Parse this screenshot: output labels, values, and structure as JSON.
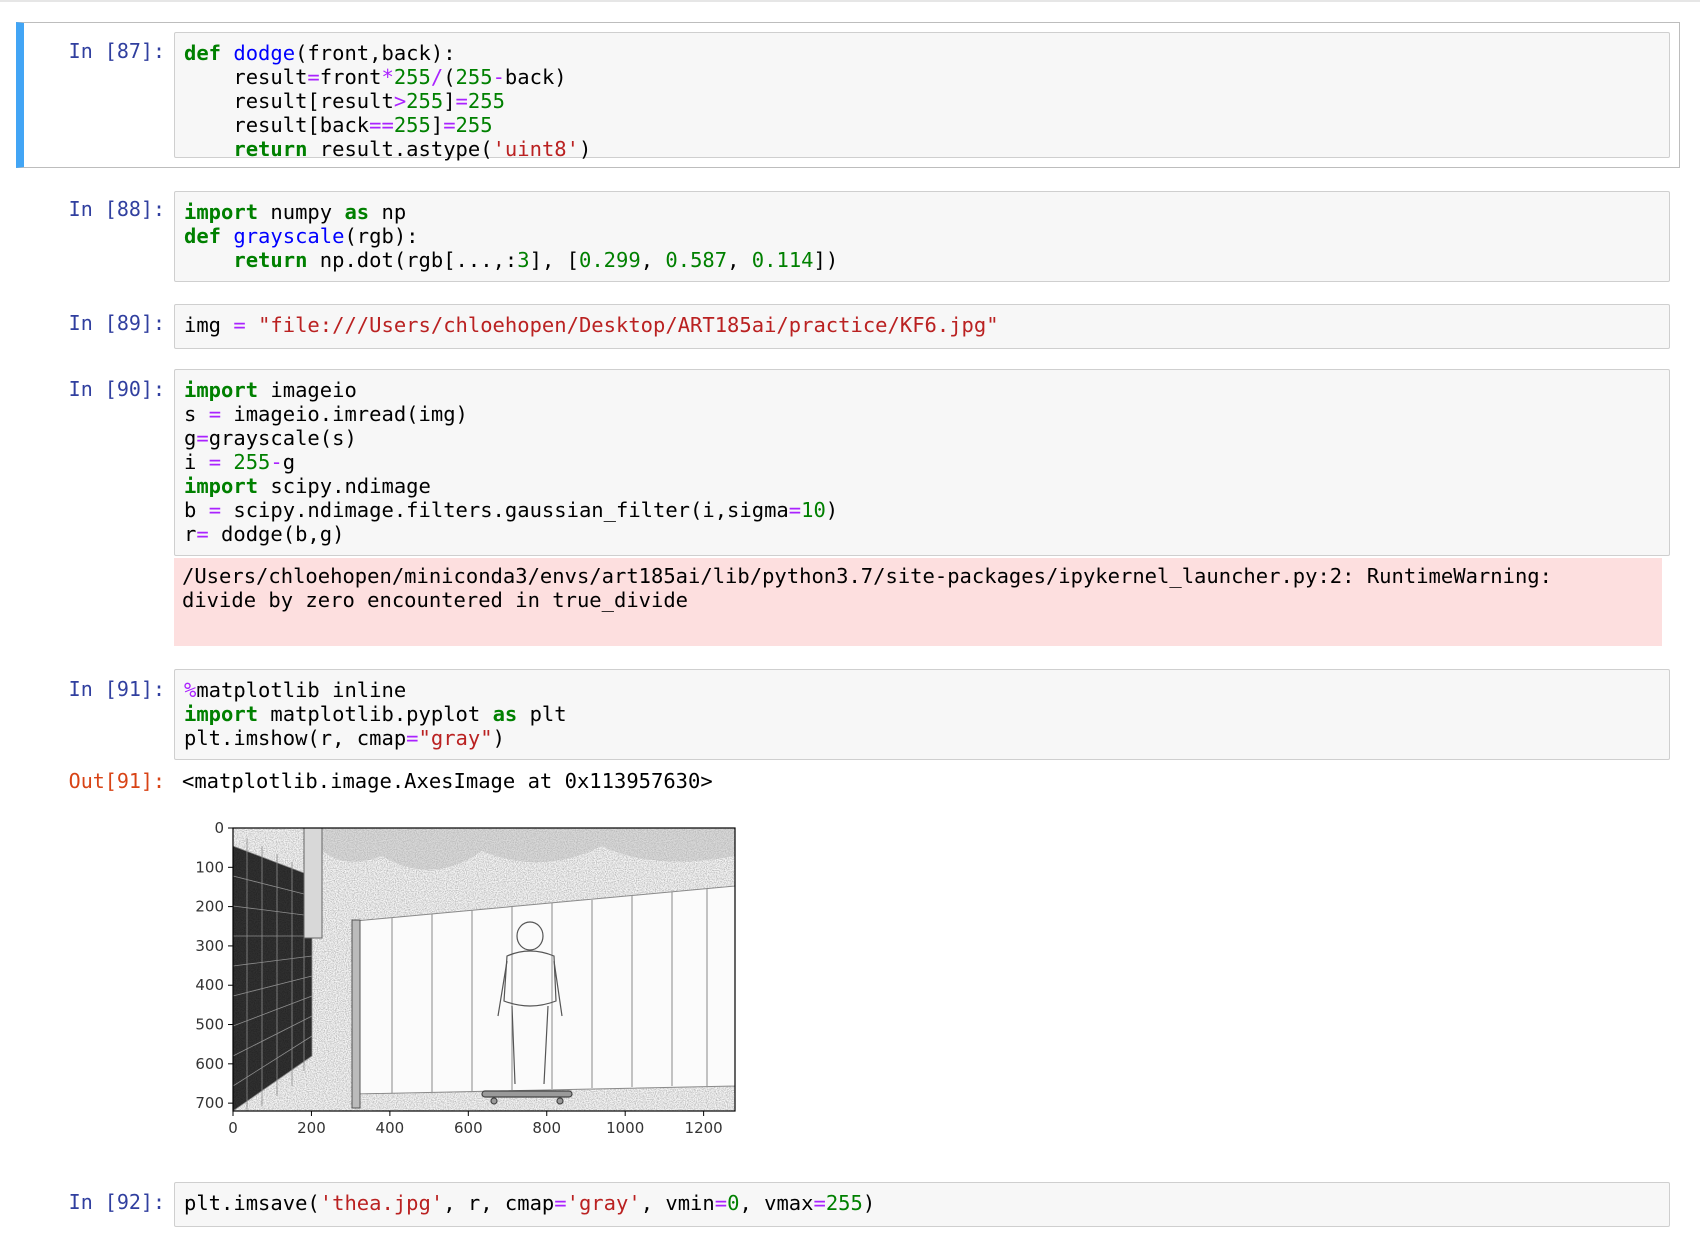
{
  "cells": [
    {
      "prompt": "In [87]:"
    },
    {
      "prompt": "In [88]:"
    },
    {
      "prompt": "In [89]:"
    },
    {
      "prompt": "In [90]:",
      "stderr": "/Users/chloehopen/miniconda3/envs/art185ai/lib/python3.7/site-packages/ipykernel_launcher.py:2: RuntimeWarning:\ndivide by zero encountered in true_divide"
    },
    {
      "prompt": "In [91]:",
      "out_prompt": "Out[91]:",
      "output": "<matplotlib.image.AxesImage at 0x113957630>"
    },
    {
      "prompt": "In [92]:"
    }
  ],
  "code": {
    "c87": [
      [
        [
          "def",
          "kw"
        ],
        [
          " ",
          ""
        ],
        [
          "dodge",
          "fn"
        ],
        [
          "(front,back):",
          ""
        ]
      ],
      [
        [
          "    result",
          ""
        ],
        [
          "=",
          "op"
        ],
        [
          "front",
          ""
        ],
        [
          "*",
          "op"
        ],
        [
          "255",
          "num"
        ],
        [
          "/",
          "op"
        ],
        [
          "(",
          ""
        ],
        [
          "255",
          "num"
        ],
        [
          "-",
          "op"
        ],
        [
          "back)",
          ""
        ]
      ],
      [
        [
          "    result[result",
          ""
        ],
        [
          ">",
          "op"
        ],
        [
          "255",
          "num"
        ],
        [
          "]",
          ""
        ],
        [
          "=",
          "op"
        ],
        [
          "255",
          "num"
        ]
      ],
      [
        [
          "    result[back",
          ""
        ],
        [
          "==",
          "op"
        ],
        [
          "255",
          "num"
        ],
        [
          "]",
          ""
        ],
        [
          "=",
          "op"
        ],
        [
          "255",
          "num"
        ]
      ],
      [
        [
          "    ",
          ""
        ],
        [
          "return",
          "kw"
        ],
        [
          " result.astype(",
          ""
        ],
        [
          "'uint8'",
          "str"
        ],
        [
          ")",
          ""
        ]
      ]
    ],
    "c88": [
      [
        [
          "import",
          "kw"
        ],
        [
          " numpy ",
          ""
        ],
        [
          "as",
          "kw"
        ],
        [
          " np",
          ""
        ]
      ],
      [
        [
          "def",
          "kw"
        ],
        [
          " ",
          ""
        ],
        [
          "grayscale",
          "fn"
        ],
        [
          "(rgb):",
          ""
        ]
      ],
      [
        [
          "    ",
          ""
        ],
        [
          "return",
          "kw"
        ],
        [
          " np.dot(rgb[...,:",
          ""
        ],
        [
          "3",
          "num"
        ],
        [
          "], [",
          ""
        ],
        [
          "0.299",
          "num"
        ],
        [
          ", ",
          ""
        ],
        [
          "0.587",
          "num"
        ],
        [
          ", ",
          ""
        ],
        [
          "0.114",
          "num"
        ],
        [
          "])",
          ""
        ]
      ]
    ],
    "c89": [
      [
        [
          "img ",
          ""
        ],
        [
          "=",
          "op"
        ],
        [
          " ",
          ""
        ],
        [
          "\"file:///Users/chloehopen/Desktop/ART185ai/practice/KF6.jpg\"",
          "str"
        ]
      ]
    ],
    "c90": [
      [
        [
          "import",
          "kw"
        ],
        [
          " imageio",
          ""
        ]
      ],
      [
        [
          "s ",
          ""
        ],
        [
          "=",
          "op"
        ],
        [
          " imageio.imread(img)",
          ""
        ]
      ],
      [
        [
          "g",
          ""
        ],
        [
          "=",
          "op"
        ],
        [
          "grayscale(s)",
          ""
        ]
      ],
      [
        [
          "i ",
          ""
        ],
        [
          "=",
          "op"
        ],
        [
          " ",
          ""
        ],
        [
          "255",
          "num"
        ],
        [
          "-",
          "op"
        ],
        [
          "g",
          ""
        ]
      ],
      [
        [
          "import",
          "kw"
        ],
        [
          " scipy.ndimage",
          ""
        ]
      ],
      [
        [
          "b ",
          ""
        ],
        [
          "=",
          "op"
        ],
        [
          " scipy.ndimage.filters.gaussian_filter(i,sigma",
          ""
        ],
        [
          "=",
          "op"
        ],
        [
          "10",
          "num"
        ],
        [
          ")",
          ""
        ]
      ],
      [
        [
          "r",
          ""
        ],
        [
          "=",
          "op"
        ],
        [
          " dodge(b,g)",
          ""
        ]
      ]
    ],
    "c91": [
      [
        [
          "%",
          "op"
        ],
        [
          "matplotlib inline",
          ""
        ]
      ],
      [
        [
          "import",
          "kw"
        ],
        [
          " matplotlib.pyplot ",
          ""
        ],
        [
          "as",
          "kw"
        ],
        [
          " plt",
          ""
        ]
      ],
      [
        [
          "plt.imshow(r, cmap",
          ""
        ],
        [
          "=",
          "op"
        ],
        [
          "\"gray\"",
          "str"
        ],
        [
          ")",
          ""
        ]
      ]
    ],
    "c92": [
      [
        [
          "plt.imsave(",
          ""
        ],
        [
          "'thea.jpg'",
          "str"
        ],
        [
          ", r, cmap",
          ""
        ],
        [
          "=",
          "op"
        ],
        [
          "'gray'",
          "str"
        ],
        [
          ", vmin",
          ""
        ],
        [
          "=",
          "op"
        ],
        [
          "0",
          "num"
        ],
        [
          ", vmax",
          ""
        ],
        [
          "=",
          "op"
        ],
        [
          "255",
          "num"
        ],
        [
          ")",
          ""
        ]
      ]
    ]
  },
  "colors": {
    "kw": "#008000",
    "fn": "#0000ff",
    "num": "#008000",
    "op": "#aa22ff",
    "str": "#ba2121",
    "in_prompt": "#303f9f",
    "out_prompt": "#d84315",
    "stderr_bg": "#fddfdf",
    "selected_border": "#42a5f5"
  },
  "chart_data": {
    "type": "image",
    "xlim": [
      0,
      1280
    ],
    "ylim": [
      720,
      0
    ],
    "xticks": [
      0,
      200,
      400,
      600,
      800,
      1000,
      1200
    ],
    "yticks": [
      0,
      100,
      200,
      300,
      400,
      500,
      600,
      700
    ],
    "image": "grayscale pencil-sketch of a backyard with fence, net and skateboarder"
  }
}
